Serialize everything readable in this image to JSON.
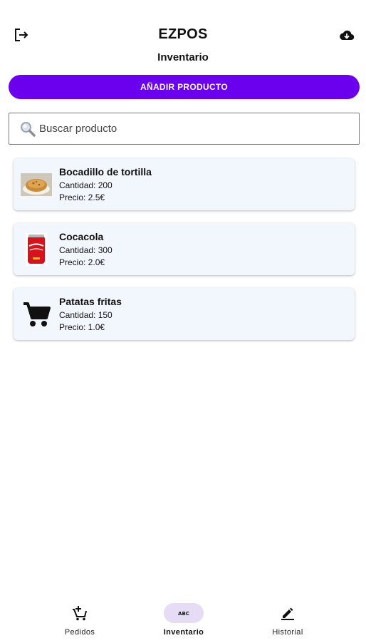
{
  "header": {
    "app_title": "EZPOS",
    "page_title": "Inventario",
    "logout_icon": "logout-icon",
    "cloud_icon": "cloud-download-icon"
  },
  "actions": {
    "add_product_label": "AÑADIR PRODUCTO"
  },
  "search": {
    "placeholder": "Buscar producto",
    "value": ""
  },
  "products": [
    {
      "name": "Bocadillo de tortilla",
      "quantity": "Cantidad: 200",
      "price": "Precio: 2.5€",
      "image": "sandwich-image"
    },
    {
      "name": "Cocacola",
      "quantity": "Cantidad: 300",
      "price": "Precio: 2.0€",
      "image": "cola-can-image"
    },
    {
      "name": "Patatas fritas",
      "quantity": "Cantidad: 150",
      "price": "Precio: 1.0€",
      "image": "shopping-cart-icon"
    }
  ],
  "nav": {
    "items": [
      {
        "label": "Pedidos",
        "icon": "add-cart-icon",
        "active": false
      },
      {
        "label": "Inventario",
        "icon": "abc-icon",
        "active": true
      },
      {
        "label": "Historial",
        "icon": "edit-icon",
        "active": false
      }
    ]
  },
  "colors": {
    "accent": "#6a00ee",
    "card_bg": "#f2f6fd",
    "nav_active_bg": "#e6dcf5"
  }
}
